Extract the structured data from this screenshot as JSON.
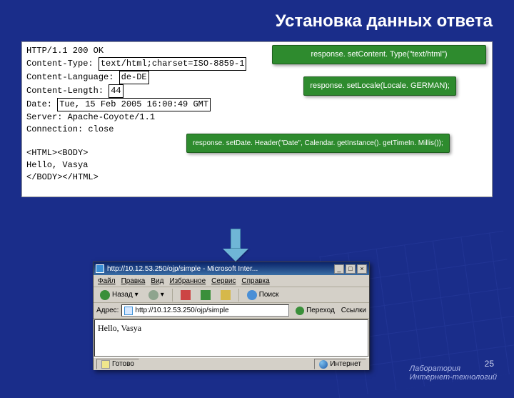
{
  "slide": {
    "title": "Установка данных ответа",
    "page_number": "25",
    "footer_lab": "Лаборатория",
    "footer_tech": "Интернет-технологий"
  },
  "http": {
    "status": "HTTP/1.1 200 OK",
    "ct_prefix": "Content-Type: ",
    "ct_value": "text/html;charset=ISO-8859-1",
    "cl_prefix": "Content-Language: ",
    "cl_value": "de-DE",
    "len_prefix": "Content-Length: ",
    "len_value": "44",
    "date_prefix": "Date: ",
    "date_value": "Tue, 15 Feb 2005 16:00:49 GMT",
    "server": "Server: Apache-Coyote/1.1",
    "conn": "Connection: close",
    "body1": "<HTML><BODY>",
    "body2": "Hello, Vasya",
    "body3": "</BODY></HTML>"
  },
  "callouts": {
    "ct": "response. set​Content. Type(\"text/html\")",
    "locale": "response. set​Locale(Locale. GERMAN);",
    "date": "response. set​Date. Header(\"Date\", Calendar. get​Instance(). get​Time​In. Millis());"
  },
  "browser": {
    "title": "http://10.12.53.250/ojp/simple - Microsoft Inter...",
    "menu": {
      "file": "Файл",
      "edit": "Правка",
      "view": "Вид",
      "fav": "Избранное",
      "tools": "Сервис",
      "help": "Справка"
    },
    "nav": {
      "back": "Назад",
      "go": "Переход",
      "links": "Ссылки"
    },
    "addr_label": "Адрес:",
    "url": "http://10.12.53.250/ojp/simple",
    "content": "Hello, Vasya",
    "status_done": "Готово",
    "status_zone": "Интернет"
  }
}
